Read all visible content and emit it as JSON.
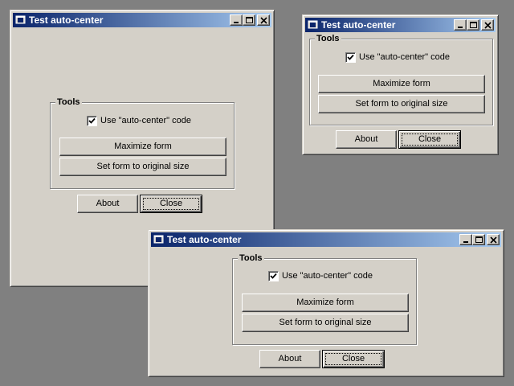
{
  "windows": [
    {
      "title": "Test auto-center",
      "group_label": "Tools",
      "checkbox": {
        "label": "Use \"auto-center\" code",
        "checked": true
      },
      "buttons": {
        "maximize": "Maximize form",
        "restore": "Set form to original size",
        "about": "About",
        "close": "Close"
      }
    },
    {
      "title": "Test auto-center",
      "group_label": "Tools",
      "checkbox": {
        "label": "Use \"auto-center\" code",
        "checked": true
      },
      "buttons": {
        "maximize": "Maximize form",
        "restore": "Set form to original size",
        "about": "About",
        "close": "Close"
      }
    },
    {
      "title": "Test auto-center",
      "group_label": "Tools",
      "checkbox": {
        "label": "Use \"auto-center\" code",
        "checked": true
      },
      "buttons": {
        "maximize": "Maximize form",
        "restore": "Set form to original size",
        "about": "About",
        "close": "Close"
      }
    }
  ],
  "colors": {
    "desktop": "#808080",
    "face": "#d4d0c8",
    "title_start": "#0a246a",
    "title_end": "#a6caf0"
  }
}
